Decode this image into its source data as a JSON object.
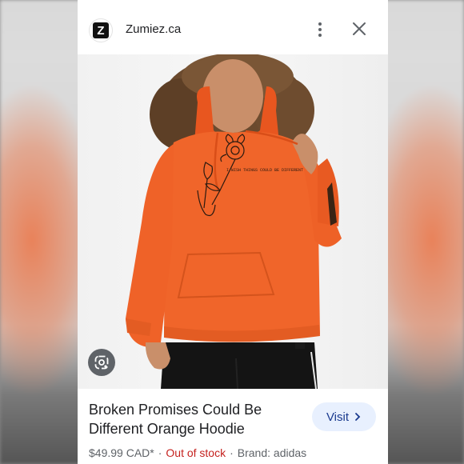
{
  "header": {
    "site_logo_letter": "Z",
    "site_name": "Zumiez.ca"
  },
  "image": {
    "graphic_text": "I WISH THINGS COULD BE DIFFERENT"
  },
  "product": {
    "title": "Broken Promises Could Be Different Orange Hoodie",
    "price": "$49.99 CAD*",
    "stock_status": "Out of stock",
    "brand": "Brand: adidas",
    "separator": "·"
  },
  "actions": {
    "visit_label": "Visit"
  },
  "colors": {
    "hoodie": "#f0652a",
    "stock_status": "#c5221f",
    "visit_button_bg": "#e8f0fe"
  }
}
